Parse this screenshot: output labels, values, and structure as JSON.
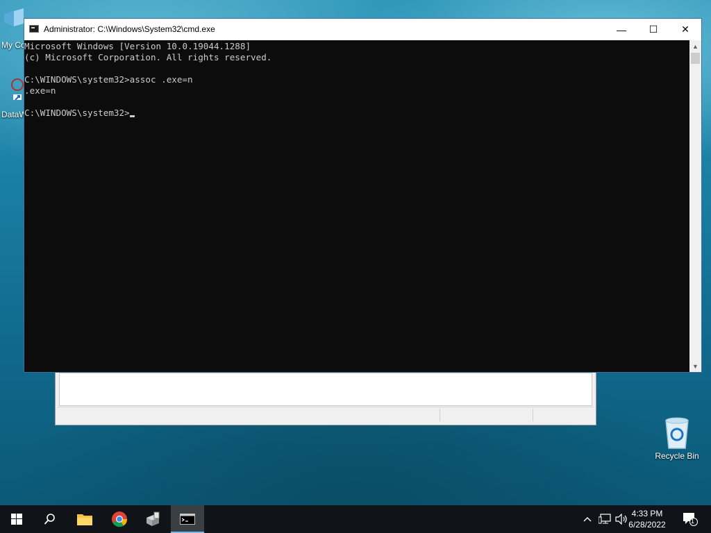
{
  "desktop": {
    "icons": [
      {
        "name": "my-computer",
        "label": "My Co"
      },
      {
        "name": "dataw",
        "label": "DataW"
      },
      {
        "name": "recycle-bin",
        "label": "Recycle Bin"
      }
    ]
  },
  "cmd_window": {
    "title": "Administrator: C:\\Windows\\System32\\cmd.exe",
    "lines": [
      "Microsoft Windows [Version 10.0.19044.1288]",
      "(c) Microsoft Corporation. All rights reserved.",
      "",
      "C:\\WINDOWS\\system32>assoc .exe=n",
      ".exe=n",
      ""
    ],
    "prompt": "C:\\WINDOWS\\system32>",
    "controls": {
      "minimize": "—",
      "maximize": "☐",
      "close": "✕"
    }
  },
  "taskbar": {
    "clock_time": "4:33 PM",
    "clock_date": "6/28/2022",
    "notification_count": "1"
  },
  "colors": {
    "console_bg": "#0c0c0c",
    "console_fg": "#cccccc",
    "taskbar": "#101418",
    "accent": "#76b9ed"
  }
}
